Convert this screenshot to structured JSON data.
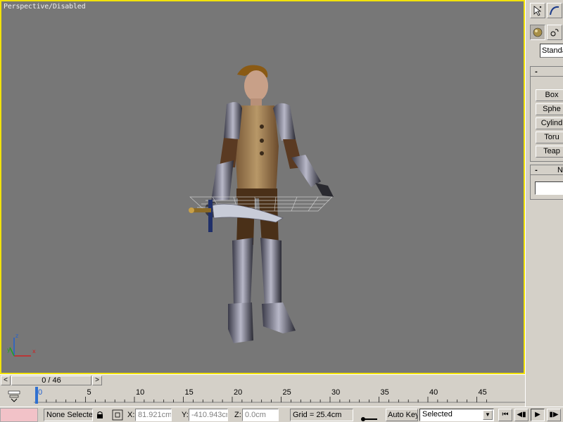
{
  "viewport": {
    "label": "Perspective/Disabled",
    "border_color": "#f2e20a",
    "background": "#777777",
    "axis": {
      "x": "x",
      "y": "y",
      "z": "z"
    }
  },
  "command_panel": {
    "tabs": [
      {
        "icon": "create-pointer-icon"
      },
      {
        "icon": "modify-curve-icon"
      }
    ],
    "categories": [
      {
        "icon": "geometry-sphere-icon",
        "active": true
      },
      {
        "icon": "shapes-icon",
        "active": false
      }
    ],
    "object_type_dropdown": "Standa",
    "rollouts": {
      "object_type": {
        "minus": "-"
      },
      "name_color": {
        "minus": "-",
        "title": "N"
      }
    },
    "object_buttons": [
      "Box",
      "Sphe",
      "Cylind",
      "Toru",
      "Teap"
    ],
    "name_field_value": ""
  },
  "time_slider": {
    "prev": "<",
    "next": ">",
    "thumb_label": "0 / 46"
  },
  "trackbar": {
    "current_frame": 0,
    "ticks": [
      "0",
      "5",
      "10",
      "15",
      "20",
      "25",
      "30",
      "35",
      "40",
      "45"
    ]
  },
  "statusbar": {
    "selection": "None Selecte",
    "x_label": "X:",
    "x_value": "81.921cm",
    "y_label": "Y:",
    "y_value": "-410.943cr",
    "z_label": "Z:",
    "z_value": "0.0cm",
    "grid": "Grid = 25.4cm",
    "auto_key": "Auto Key",
    "key_filter_value": "Selected",
    "dropdown_arrow": "▼",
    "playback": [
      "⏮",
      "◀▮",
      "▶",
      "▮▶",
      "▶|"
    ]
  }
}
